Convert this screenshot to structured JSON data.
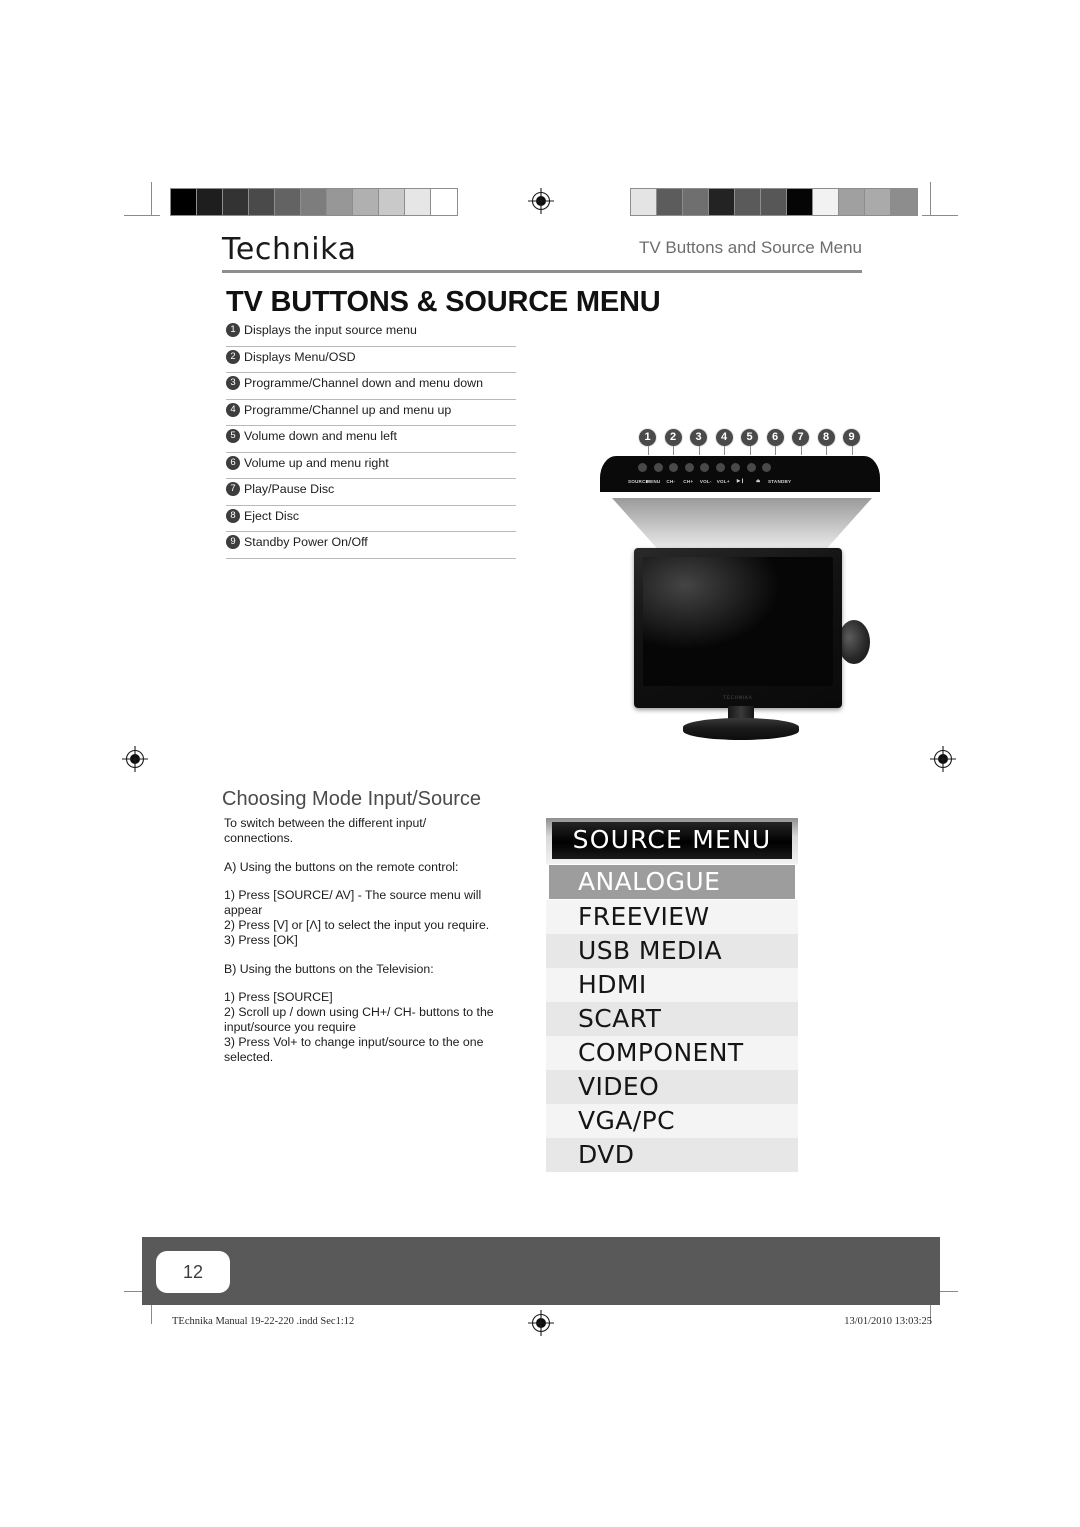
{
  "header": {
    "brand": "Technika",
    "running_head": "TV Buttons and Source Menu",
    "page_title": "TV BUTTONS & SOURCE MENU"
  },
  "legend": {
    "items": [
      {
        "num": "1",
        "label": "Displays the input source menu"
      },
      {
        "num": "2",
        "label": "Displays Menu/OSD"
      },
      {
        "num": "3",
        "label": "Programme/Channel down and menu down"
      },
      {
        "num": "4",
        "label": "Programme/Channel up and menu up"
      },
      {
        "num": "5",
        "label": "Volume down and menu left"
      },
      {
        "num": "6",
        "label": "Volume up and menu right"
      },
      {
        "num": "7",
        "label": "Play/Pause Disc"
      },
      {
        "num": "8",
        "label": "Eject Disc"
      },
      {
        "num": "9",
        "label": "Standby Power On/Off"
      }
    ]
  },
  "button_panel": {
    "callouts": [
      "1",
      "2",
      "3",
      "4",
      "5",
      "6",
      "7",
      "8",
      "9"
    ],
    "labels": [
      "SOURCE",
      "MENU",
      "CH-",
      "CH+",
      "VOL-",
      "VOL+",
      "▶❙",
      "⏏",
      "STANDBY"
    ],
    "tv_logo": "TECHNIKA"
  },
  "section": {
    "heading": "Choosing Mode Input/Source",
    "intro": "To switch between the different input/ connections.",
    "part_a_heading": "A) Using the buttons on the remote control:",
    "part_a_steps": [
      "1) Press [SOURCE/ AV] - The source menu will appear",
      "2) Press [V] or [Λ] to select the input you require.",
      "3) Press [OK]"
    ],
    "part_b_heading": "B) Using the buttons on the Television:",
    "part_b_steps": [
      "1) Press [SOURCE]",
      "2) Scroll up / down using CH+/ CH- buttons to the input/source you require",
      "3) Press Vol+ to change input/source to the one selected."
    ]
  },
  "osd": {
    "title": "SOURCE MENU",
    "selected": "ANALOGUE",
    "items": [
      "FREEVIEW",
      "USB MEDIA",
      "HDMI",
      "SCART",
      "COMPONENT",
      "VIDEO",
      "VGA/PC",
      "DVD"
    ]
  },
  "footer": {
    "page_number": "12",
    "file_line": "TEchnika Manual 19-22-220 .indd   Sec1:12",
    "timestamp": "13/01/2010   13:03:25"
  },
  "colorbars": {
    "left": [
      "#000000",
      "#1e1e1e",
      "#333333",
      "#4a4a4a",
      "#636363",
      "#7d7d7d",
      "#979797",
      "#b0b0b0",
      "#c9c9c9",
      "#e6e6e6",
      "#ffffff"
    ],
    "right": [
      "#e4e4e4",
      "#5c5c5c",
      "#6f6f6f",
      "#232323",
      "#5a5a5a",
      "#575757",
      "#050505",
      "#f2f2f2",
      "#a0a0a0",
      "#aaaaaa",
      "#8d8d8d"
    ]
  }
}
